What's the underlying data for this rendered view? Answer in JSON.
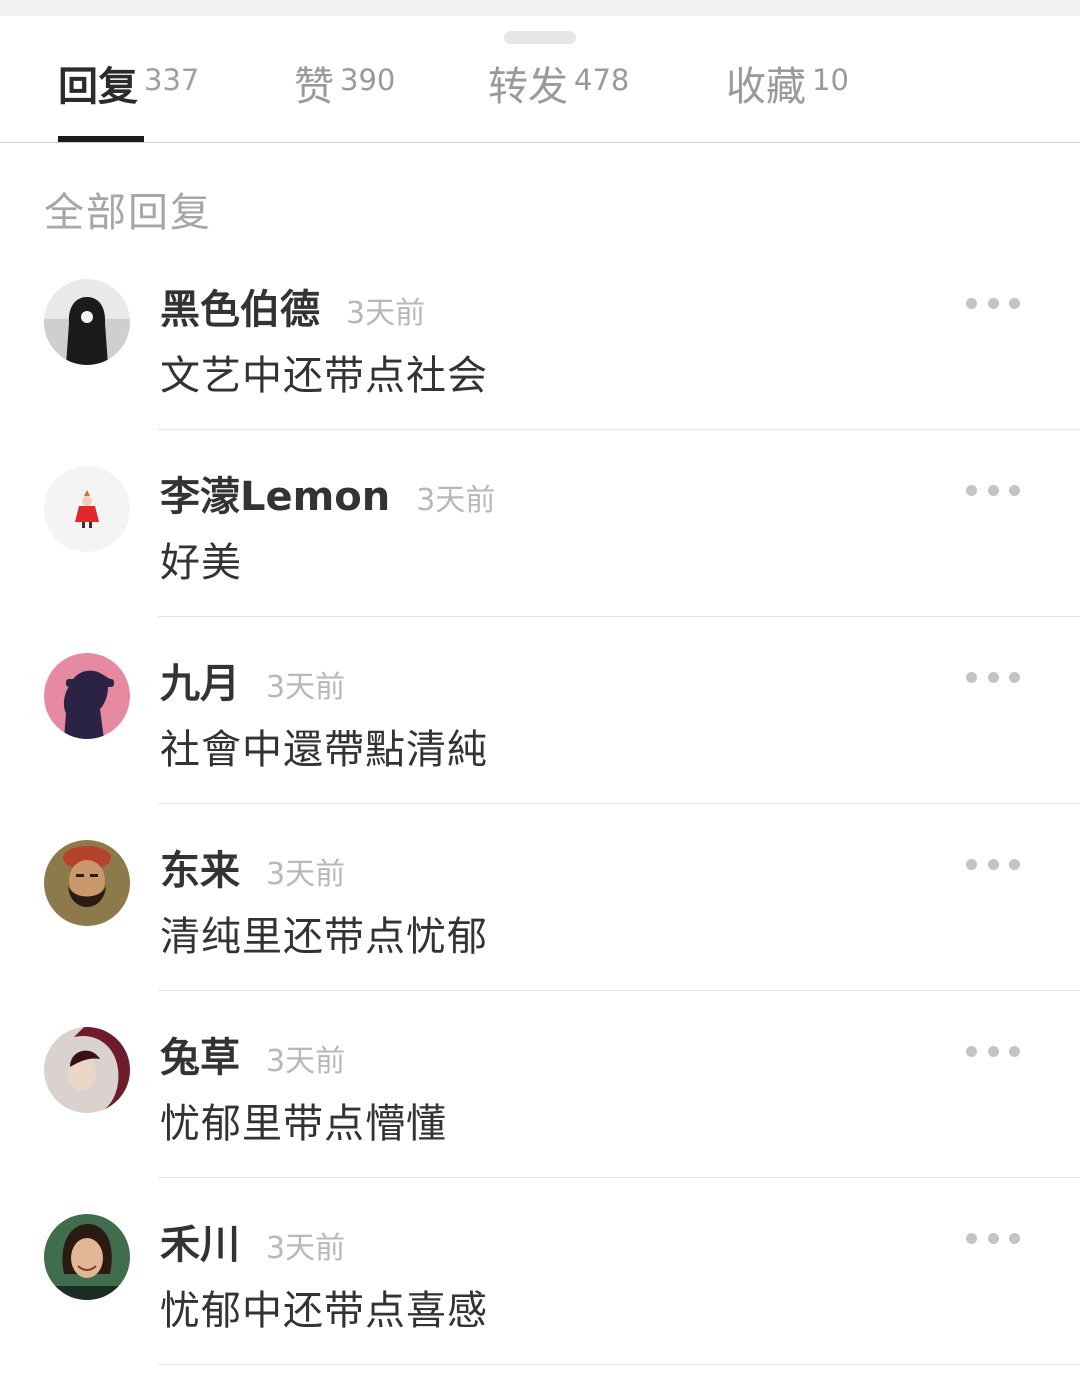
{
  "tabs": [
    {
      "label": "回复",
      "count": "337",
      "active": true
    },
    {
      "label": "赞",
      "count": "390",
      "active": false
    },
    {
      "label": "转发",
      "count": "478",
      "active": false
    },
    {
      "label": "收藏",
      "count": "10",
      "active": false
    }
  ],
  "section_title": "全部回复",
  "more_icon": "more-dots-icon",
  "replies": [
    {
      "username": "黑色伯德",
      "time": "3天前",
      "content": "文艺中还带点社会",
      "avatar": "hooded-figure-avatar"
    },
    {
      "username": "李濛Lemon",
      "time": "3天前",
      "content": "好美",
      "avatar": "little-my-avatar"
    },
    {
      "username": "九月",
      "time": "3天前",
      "content": "社會中還帶點清純",
      "avatar": "silhouette-avatar"
    },
    {
      "username": "东来",
      "time": "3天前",
      "content": "清纯里还带点忧郁",
      "avatar": "bearded-man-avatar"
    },
    {
      "username": "兔草",
      "time": "3天前",
      "content": "忧郁里带点懵懂",
      "avatar": "girl-portrait-avatar"
    },
    {
      "username": "禾川",
      "time": "3天前",
      "content": "忧郁中还带点喜感",
      "avatar": "smiling-woman-avatar"
    }
  ]
}
